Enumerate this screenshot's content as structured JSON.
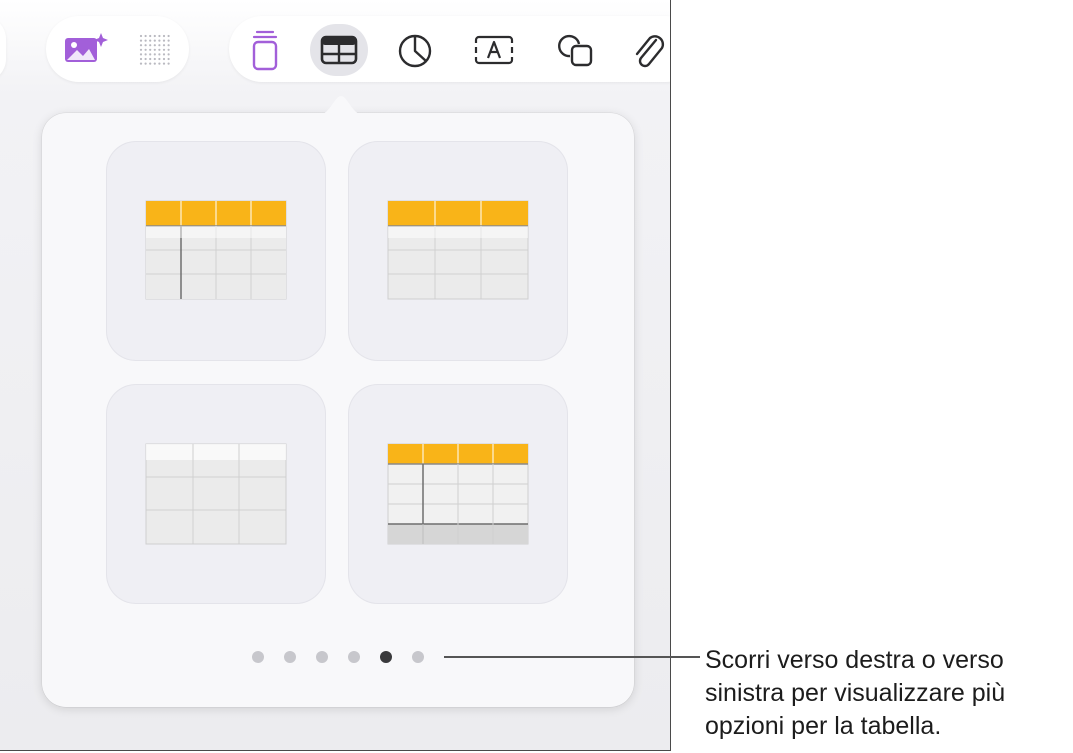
{
  "toolbar": {
    "left_group": [
      {
        "icon": "image-sparkle-icon",
        "active": false
      },
      {
        "icon": "dot-grid-icon",
        "active": false
      }
    ],
    "insert_group": [
      {
        "icon": "layers-icon",
        "active": false
      },
      {
        "icon": "table-icon",
        "active": true
      },
      {
        "icon": "pie-chart-icon",
        "active": false
      },
      {
        "icon": "text-box-icon",
        "active": false
      },
      {
        "icon": "shape-icon",
        "active": false
      },
      {
        "icon": "paperclip-icon",
        "active": false
      }
    ]
  },
  "colors": {
    "accent": "#a25fd9",
    "header_yellow": "#f9b418",
    "icon_dark": "#2c2c2e",
    "dot_inactive": "#c7c7cc",
    "dot_active": "#3a3a3c"
  },
  "table_styles": [
    {
      "name": "header-row-and-column-yellow"
    },
    {
      "name": "header-row-yellow"
    },
    {
      "name": "plain-gray"
    },
    {
      "name": "header-row-column-and-footer"
    }
  ],
  "pagination": {
    "total": 6,
    "current_index": 4
  },
  "callout": {
    "text": "Scorri verso destra o verso\nsinistra per visualizzare più\nopzioni per la tabella."
  }
}
